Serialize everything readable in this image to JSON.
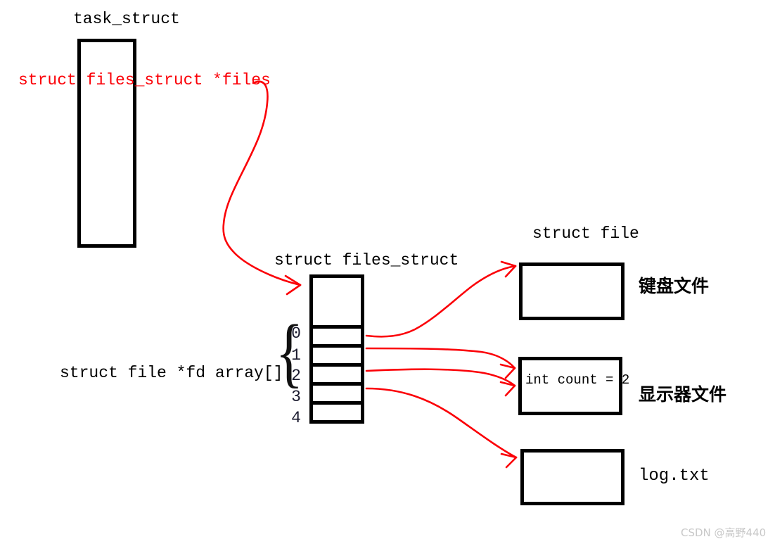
{
  "diagram": {
    "title_task_struct": "task_struct",
    "title_files_struct": "struct files_struct",
    "title_struct_file": "struct file",
    "pointer_label": "struct files_struct *files",
    "fd_array_label": "struct file *fd array[]",
    "brace_glyph": "{",
    "fd_indices": [
      "0",
      "1",
      "2",
      "3",
      "4"
    ],
    "files": [
      {
        "name": "file-keyboard",
        "label": "键盘文件",
        "content": ""
      },
      {
        "name": "file-monitor",
        "label": "显示器文件",
        "content": "int count = 2"
      },
      {
        "name": "file-log",
        "label": "log.txt",
        "content": ""
      }
    ],
    "colors": {
      "arrow_red": "#fb0007",
      "box_border": "#000000",
      "index_text": "#1a1a2e",
      "watermark": "#c8c8c8"
    },
    "watermark": "CSDN @高野440"
  }
}
